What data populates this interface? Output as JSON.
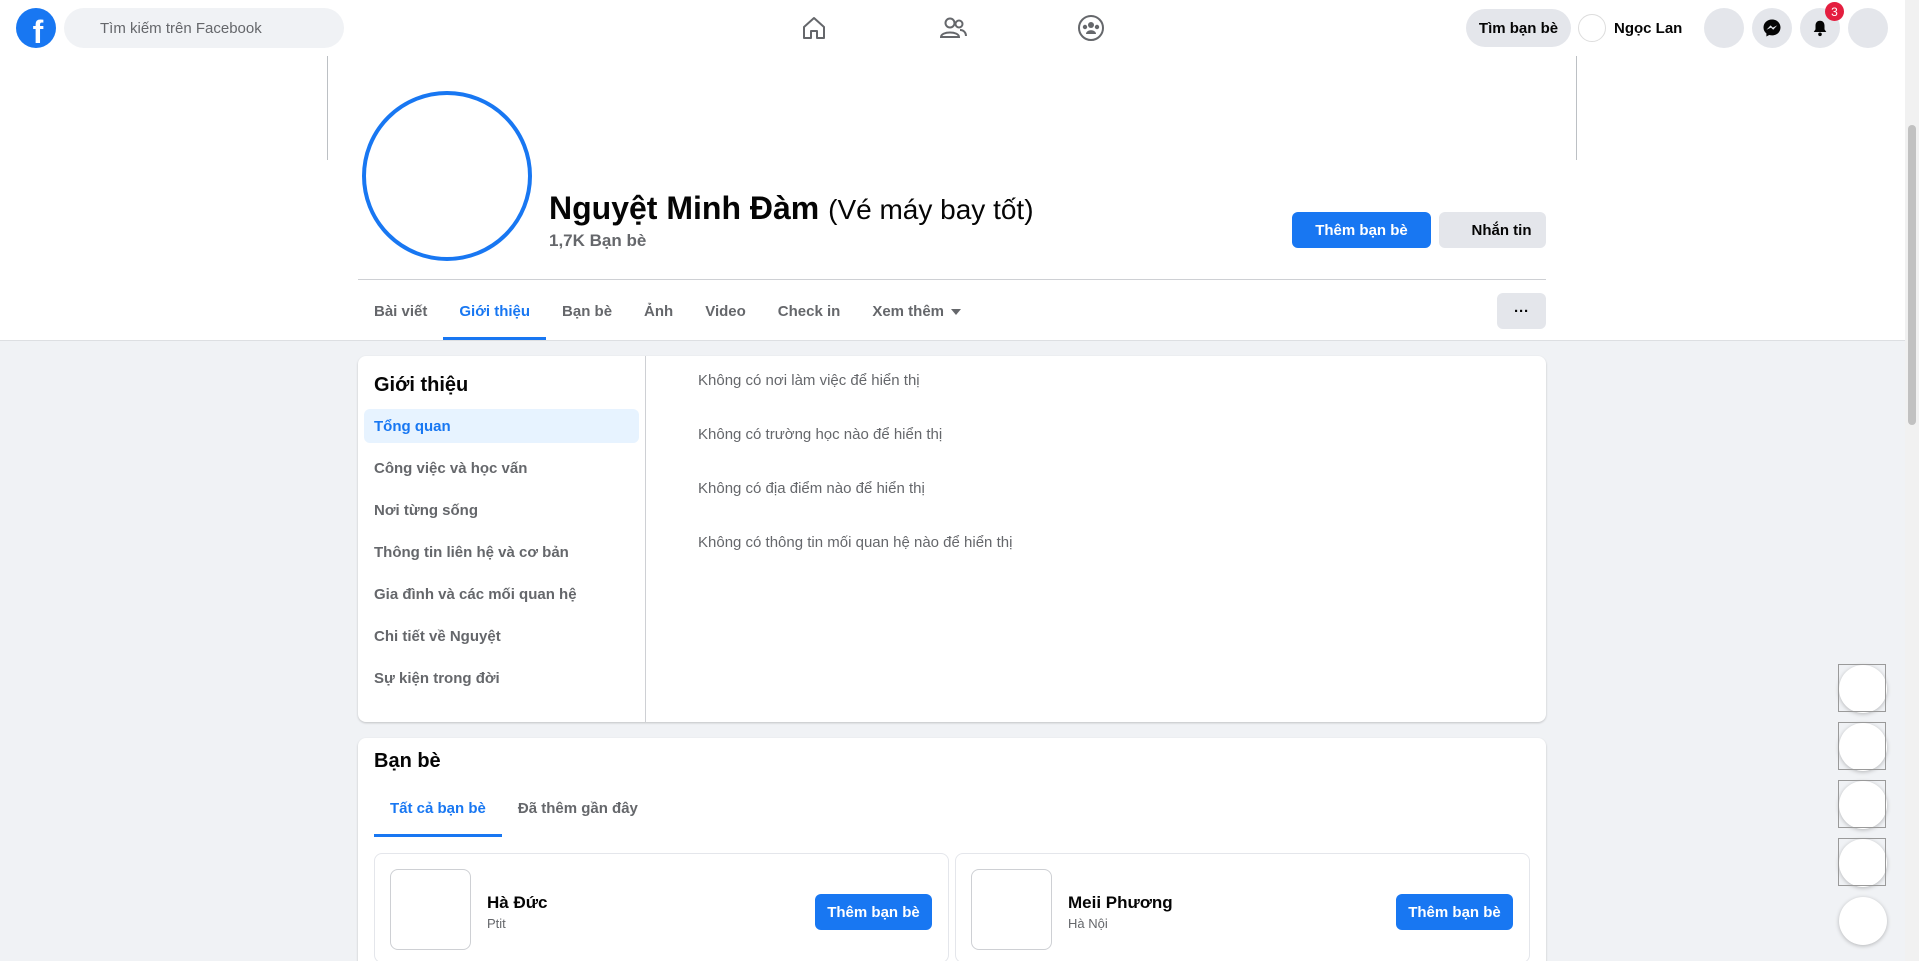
{
  "topnav": {
    "logo": "f",
    "search_placeholder": "Tìm kiếm trên Facebook",
    "icons": [
      "home-icon",
      "friends-icon",
      "groups-icon"
    ],
    "find_friends": "Tìm bạn bè",
    "user_name": "Ngọc Lan",
    "notification_count": "3"
  },
  "profile": {
    "name": "Nguyệt Minh Đàm",
    "alt_name": "(Vé máy bay tốt)",
    "friend_count": "1,7K Bạn bè",
    "add_friend": "Thêm bạn bè",
    "message": "Nhắn tin"
  },
  "tabs": [
    {
      "label": "Bài viết"
    },
    {
      "label": "Giới thiệu"
    },
    {
      "label": "Bạn bè"
    },
    {
      "label": "Ảnh"
    },
    {
      "label": "Video"
    },
    {
      "label": "Check in"
    },
    {
      "label": "Xem thêm"
    }
  ],
  "more_button": "···",
  "intro": {
    "title": "Giới thiệu",
    "items": [
      {
        "label": "Tổng quan"
      },
      {
        "label": "Công việc và học vấn"
      },
      {
        "label": "Nơi từng sống"
      },
      {
        "label": "Thông tin liên hệ và cơ bản"
      },
      {
        "label": "Gia đình và các mối quan hệ"
      },
      {
        "label": "Chi tiết về Nguyệt"
      },
      {
        "label": "Sự kiện trong đời"
      }
    ],
    "lines": [
      "Không có nơi làm việc để hiển thị",
      "Không có trường học nào để hiển thị",
      "Không có địa điểm nào để hiển thị",
      "Không có thông tin mối quan hệ nào để hiển thị"
    ]
  },
  "friends": {
    "title": "Bạn bè",
    "tabs": [
      {
        "label": "Tất cả bạn bè"
      },
      {
        "label": "Đã thêm gần đây"
      }
    ],
    "list": [
      {
        "name": "Hà Đức",
        "sub": "Ptit",
        "button": "Thêm bạn bè"
      },
      {
        "name": "Meii Phương",
        "sub": "Hà Nội",
        "button": "Thêm bạn bè"
      }
    ]
  },
  "colors": {
    "accent": "#1877f2",
    "background": "#f0f2f5",
    "secondary_text": "#65676b",
    "badge": "#e41e3f"
  }
}
